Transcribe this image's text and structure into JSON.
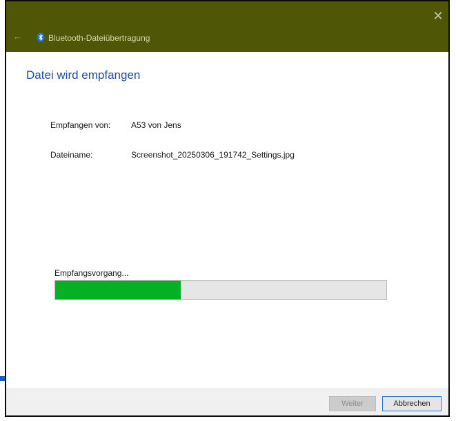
{
  "window": {
    "title": "Bluetooth-Dateiübertragung",
    "close_glyph": "✕",
    "back_glyph": "←"
  },
  "heading": "Datei wird empfangen",
  "details": {
    "received_from_label": "Empfangen von:",
    "received_from_value": "A53 von Jens",
    "filename_label": "Dateiname:",
    "filename_value": "Screenshot_20250306_191742_Settings.jpg"
  },
  "progress": {
    "label": "Empfangsvorgang...",
    "fraction": 0.38
  },
  "buttons": {
    "next_label": "Weiter",
    "cancel_label": "Abbrechen"
  },
  "colors": {
    "titlebar": "#4f5707",
    "heading": "#1f4e9c",
    "progress_fill": "#06b025",
    "bluetooth_icon": "#1f6fd1"
  },
  "icons": {
    "bluetooth": "bluetooth-icon",
    "close": "close-icon",
    "back": "back-arrow-icon"
  }
}
